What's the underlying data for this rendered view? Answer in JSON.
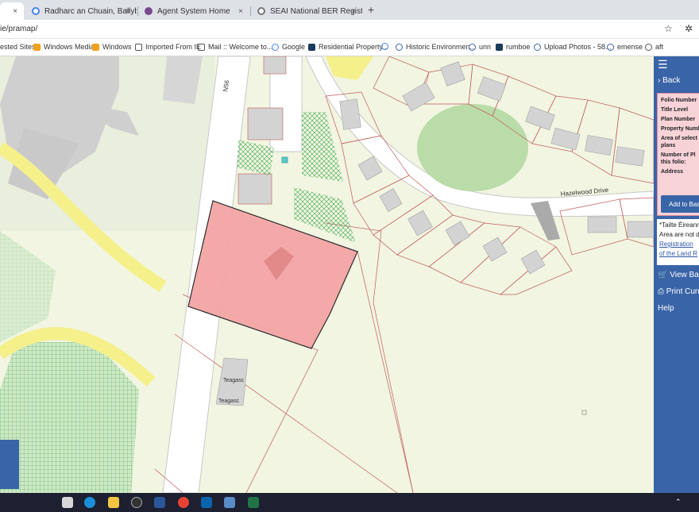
{
  "browser": {
    "tabs": [
      {
        "title": "",
        "active": true
      },
      {
        "title": "Radharc an Chuain, Ballyboe, R..."
      },
      {
        "title": "Agent System Home"
      },
      {
        "title": "SEAI National BER Register"
      }
    ],
    "new_tab": "+",
    "url": "ie/pramap/",
    "close_glyph": "×"
  },
  "bookmarks": [
    "ested Sites",
    "Windows Media",
    "Windows",
    "Imported From IE",
    "Mail :: Welcome to...",
    "Google",
    "Residential Property...",
    "",
    "Historic Environmen...",
    "unn",
    "rumboe",
    "Upload Photos - 58...",
    "emense",
    "aft"
  ],
  "map": {
    "road_labels": {
      "n56": "N56",
      "hazelwood": "Hazelwood Drive"
    },
    "building_labels": [
      "Teagasc",
      "Teagasc"
    ],
    "selected_parcel_color": "#f4a5a5"
  },
  "panel": {
    "back_label": "Back",
    "fields": [
      "Folio Number",
      "Title Level",
      "Plan Number",
      "Property Numb",
      "Area of select",
      "plans",
      "Number of Pl",
      "this folio:",
      "Address"
    ],
    "add_button": "Add to Bas",
    "notice_lines": [
      "*Tailte Éireann",
      "Area are not d",
      "Registration",
      "of the Land R"
    ],
    "view_basket": "View Bask",
    "print": "Print Curr",
    "help": "Help"
  }
}
